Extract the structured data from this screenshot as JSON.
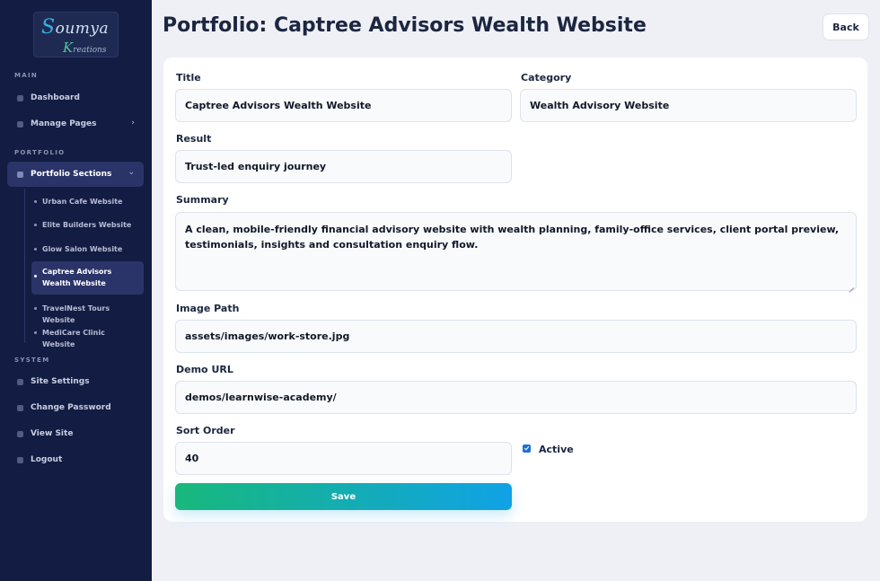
{
  "brand": {
    "name": "Soumya",
    "sub": "Kreations"
  },
  "sidebar": {
    "sections": {
      "main": "MAIN",
      "portfolio": "PORTFOLIO",
      "system": "SYSTEM"
    },
    "main_items": [
      {
        "label": "Dashboard"
      },
      {
        "label": "Manage Pages"
      }
    ],
    "portfolio_section": {
      "label": "Portfolio Sections"
    },
    "portfolio_items": [
      {
        "label": "Urban Cafe Website"
      },
      {
        "label": "Elite Builders Website"
      },
      {
        "label": "Glow Salon Website"
      },
      {
        "label": "Captree Advisors Wealth Website"
      },
      {
        "label": "TravelNest Tours Website"
      },
      {
        "label": "MediCare Clinic Website"
      }
    ],
    "system_items": [
      {
        "label": "Site Settings"
      },
      {
        "label": "Change Password"
      },
      {
        "label": "View Site"
      },
      {
        "label": "Logout"
      }
    ]
  },
  "header": {
    "title": "Portfolio: Captree Advisors Wealth Website",
    "back_label": "Back"
  },
  "form": {
    "title": {
      "label": "Title",
      "value": "Captree Advisors Wealth Website"
    },
    "category": {
      "label": "Category",
      "value": "Wealth Advisory Website"
    },
    "result": {
      "label": "Result",
      "value": "Trust-led enquiry journey"
    },
    "summary": {
      "label": "Summary",
      "value": "A clean, mobile-friendly financial advisory website with wealth planning, family-office services, client portal preview, testimonials, insights and consultation enquiry flow."
    },
    "image_path": {
      "label": "Image Path",
      "value": "assets/images/work-store.jpg"
    },
    "demo_url": {
      "label": "Demo URL",
      "value": "demos/learnwise-academy/"
    },
    "sort_order": {
      "label": "Sort Order",
      "value": "40"
    },
    "active": {
      "label": "Active",
      "checked": true
    },
    "save_label": "Save"
  },
  "colors": {
    "sidebar_bg": "#131c42",
    "active_bg": "#2b3468",
    "save_gradient_start": "#18b87c",
    "save_gradient_end": "#10a2e6",
    "checkbox": "#1d70d6"
  }
}
